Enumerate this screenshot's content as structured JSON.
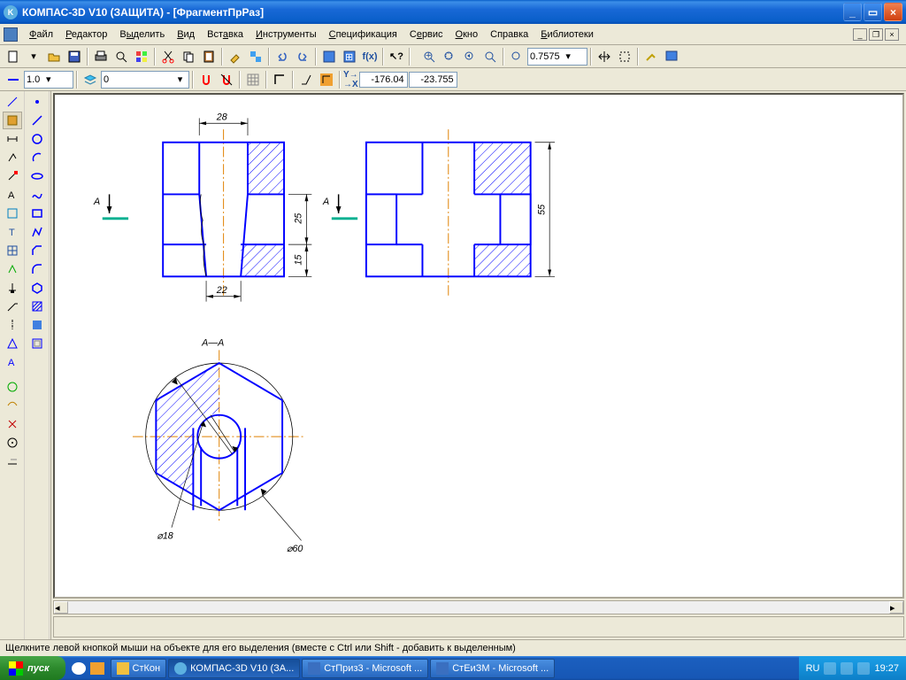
{
  "app": {
    "title": "КОМПАС-3D V10 (ЗАЩИТА) - [ФрагментПрРаз]"
  },
  "menu": {
    "file": "Файл",
    "edit": "Редактор",
    "select": "Выделить",
    "view": "Вид",
    "insert": "Вставка",
    "tools": "Инструменты",
    "spec": "Спецификация",
    "service": "Сервис",
    "window": "Окно",
    "help": "Справка",
    "lib": "Библиотеки"
  },
  "toolbar1": {
    "zoom": "0.7575"
  },
  "toolbar2": {
    "style": "1.0",
    "layer": "0",
    "xy_label": "Y→X",
    "x": "-176.04",
    "y": "-23.755"
  },
  "drawing": {
    "dims": {
      "w28": "28",
      "w22": "22",
      "h25": "25",
      "h15": "15",
      "h55": "55",
      "d18": "⌀18",
      "d60": "⌀60"
    },
    "section_label": "А—А",
    "arrow_a1": "А",
    "arrow_a2": "А"
  },
  "status": {
    "text": "Щелкните левой кнопкой мыши на объекте для его выделения (вместе с Ctrl или Shift - добавить к выделенным)"
  },
  "taskbar": {
    "start": "пуск",
    "items": [
      {
        "label": "СтКон"
      },
      {
        "label": "КОМПАС-3D V10 (ЗА..."
      },
      {
        "label": "СтПриз3 - Microsoft ..."
      },
      {
        "label": "СтЕиЗМ - Microsoft ..."
      }
    ],
    "lang": "RU",
    "time": "19:27"
  },
  "chart_data": {
    "type": "engineering-drawing",
    "views": [
      {
        "name": "front",
        "dims": {
          "top_width": 28,
          "bottom_width": 22,
          "step_h1": 25,
          "step_h2": 15
        }
      },
      {
        "name": "side",
        "dims": {
          "height": 55
        }
      },
      {
        "name": "section A-A",
        "dims": {
          "inner_diam": 18,
          "outer_diam": 60
        }
      }
    ]
  }
}
